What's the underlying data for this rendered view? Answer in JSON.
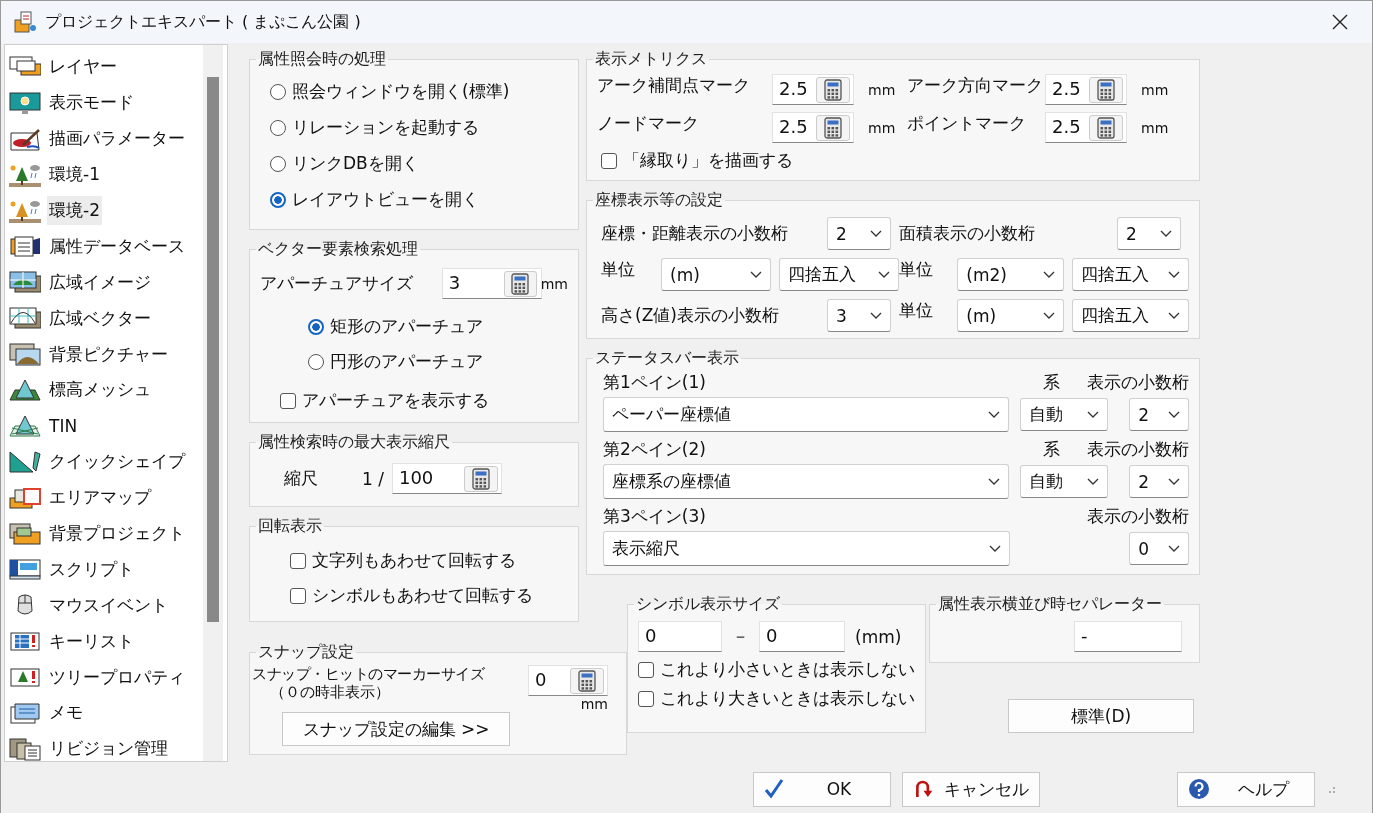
{
  "window": {
    "title": "プロジェクトエキスパート ( まぷこん公園 )"
  },
  "sidebar": {
    "items": [
      {
        "label": "レイヤー",
        "selected": false
      },
      {
        "label": "表示モード",
        "selected": false
      },
      {
        "label": "描画パラメーター",
        "selected": false
      },
      {
        "label": "環境-1",
        "selected": false
      },
      {
        "label": "環境-2",
        "selected": true
      },
      {
        "label": "属性データベース",
        "selected": false
      },
      {
        "label": "広域イメージ",
        "selected": false
      },
      {
        "label": "広域ベクター",
        "selected": false
      },
      {
        "label": "背景ピクチャー",
        "selected": false
      },
      {
        "label": "標高メッシュ",
        "selected": false
      },
      {
        "label": "TIN",
        "selected": false
      },
      {
        "label": "クイックシェイプ",
        "selected": false
      },
      {
        "label": "エリアマップ",
        "selected": false
      },
      {
        "label": "背景プロジェクト",
        "selected": false
      },
      {
        "label": "スクリプト",
        "selected": false
      },
      {
        "label": "マウスイベント",
        "selected": false
      },
      {
        "label": "キーリスト",
        "selected": false
      },
      {
        "label": "ツリープロパティ",
        "selected": false
      },
      {
        "label": "メモ",
        "selected": false
      },
      {
        "label": "リビジョン管理",
        "selected": false
      }
    ]
  },
  "attribute_query": {
    "title": "属性照会時の処理",
    "options": [
      {
        "label": "照会ウィンドウを開く(標準)",
        "selected": false
      },
      {
        "label": "リレーションを起動する",
        "selected": false
      },
      {
        "label": "リンクDBを開く",
        "selected": false
      },
      {
        "label": "レイアウトビューを開く",
        "selected": true
      }
    ]
  },
  "vector_search": {
    "title": "ベクター要素検索処理",
    "aperture_label": "アパーチュアサイズ",
    "aperture_value": "3",
    "unit": "mm",
    "shapes": [
      {
        "label": "矩形のアパーチュア",
        "selected": true
      },
      {
        "label": "円形のアパーチュア",
        "selected": false
      }
    ],
    "show_aperture": {
      "label": "アパーチュアを表示する",
      "checked": false
    }
  },
  "max_scale": {
    "title": "属性検索時の最大表示縮尺",
    "label": "縮尺",
    "prefix": "1 /",
    "value": "100"
  },
  "rotation": {
    "title": "回転表示",
    "options": [
      {
        "label": "文字列もあわせて回転する",
        "checked": false
      },
      {
        "label": "シンボルもあわせて回転する",
        "checked": false
      }
    ]
  },
  "snap": {
    "title": "スナップ設定",
    "label": "スナップ・ヒットのマーカーサイズ",
    "note": "（０の時非表示）",
    "value": "0",
    "unit": "mm",
    "button": "スナップ設定の編集 >>"
  },
  "metrics": {
    "title": "表示メトリクス",
    "fields": [
      {
        "label": "アーク補間点マーク",
        "value": "2.5",
        "unit": "mm"
      },
      {
        "label": "アーク方向マーク",
        "value": "2.5",
        "unit": "mm"
      },
      {
        "label": "ノードマーク",
        "value": "2.5",
        "unit": "mm"
      },
      {
        "label": "ポイントマーク",
        "value": "2.5",
        "unit": "mm"
      }
    ],
    "outline": {
      "label": "「縁取り」を描画する",
      "checked": false
    }
  },
  "coordinates": {
    "title": "座標表示等の設定",
    "cells": [
      {
        "kind": "digits",
        "label": "座標・距離表示の小数桁",
        "value": "2"
      },
      {
        "kind": "digits",
        "label": "面積表示の小数桁",
        "value": "2"
      },
      {
        "kind": "units",
        "label": "単位",
        "unit": "(m)",
        "rounding": "四捨五入"
      },
      {
        "kind": "units",
        "label": "単位",
        "unit": "(m2)",
        "rounding": "四捨五入"
      },
      {
        "kind": "digits",
        "label": "高さ(Z値)表示の小数桁",
        "value": "3"
      },
      {
        "kind": "units",
        "label": "単位",
        "unit": "(m)",
        "rounding": "四捨五入"
      }
    ]
  },
  "status_bar_display": {
    "title": "ステータスバー表示",
    "panes": [
      {
        "label": "第1ペイン(1)",
        "value": "ペーパー座標値",
        "system_label": "系",
        "system": "自動",
        "digits_label": "表示の小数桁",
        "digits": "2"
      },
      {
        "label": "第2ペイン(2)",
        "value": "座標系の座標値",
        "system_label": "系",
        "system": "自動",
        "digits_label": "表示の小数桁",
        "digits": "2"
      },
      {
        "label": "第3ペイン(3)",
        "value": "表示縮尺",
        "digits_label": "表示の小数桁",
        "digits": "0"
      }
    ]
  },
  "symbol_size": {
    "title": "シンボル表示サイズ",
    "min": "0",
    "separator": "－",
    "max": "0",
    "unit": "(mm)",
    "options": [
      {
        "label": "これより小さいときは表示しない",
        "checked": false
      },
      {
        "label": "これより大きいときは表示しない",
        "checked": false
      }
    ]
  },
  "separator": {
    "title": "属性表示横並び時セパレーター",
    "value": "-"
  },
  "default_button": "標準(D)",
  "buttons": [
    {
      "label": "OK",
      "kind": "ok"
    },
    {
      "label": "キャンセル",
      "kind": "cancel"
    },
    {
      "label": "ヘルプ",
      "kind": "help"
    }
  ]
}
